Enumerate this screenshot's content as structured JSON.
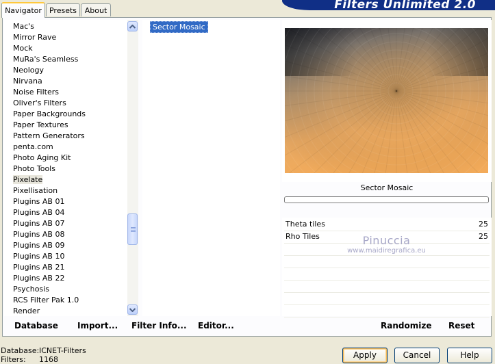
{
  "tabs": [
    "Navigator",
    "Presets",
    "About"
  ],
  "banner_title": "Filters Unlimited 2.0",
  "categories": [
    "Mac's",
    "Mirror Rave",
    "Mock",
    "MuRa's Seamless",
    "Neology",
    "Nirvana",
    "Noise Filters",
    "Oliver's Filters",
    "Paper Backgrounds",
    "Paper Textures",
    "Pattern Generators",
    "penta.com",
    "Photo Aging Kit",
    "Photo Tools",
    "Pixelate",
    "Pixellisation",
    "Plugins AB 01",
    "Plugins AB 04",
    "Plugins AB 07",
    "Plugins AB 08",
    "Plugins AB 09",
    "Plugins AB 10",
    "Plugins AB 21",
    "Plugins AB 22",
    "Psychosis",
    "RCS Filter Pak 1.0",
    "Render"
  ],
  "selected_category": "Pixelate",
  "filters": [
    "Sector Mosaic"
  ],
  "selected_filter": "Sector Mosaic",
  "preview": {
    "filter_name": "Sector Mosaic"
  },
  "params": [
    {
      "label": "Theta tiles",
      "value": "25"
    },
    {
      "label": "Rho Tiles",
      "value": "25"
    }
  ],
  "watermark": {
    "name": "Pinuccia",
    "site": "www.maidiregrafica.eu"
  },
  "bottom_left_buttons": [
    "Database",
    "Import...",
    "Filter Info...",
    "Editor..."
  ],
  "bottom_right_buttons": [
    "Randomize",
    "Reset"
  ],
  "status": {
    "database_label": "Database:",
    "database_value": "ICNET-Filters",
    "filters_label": "Filters:",
    "filters_value": "1168"
  },
  "dialog_buttons": {
    "apply": "Apply",
    "cancel": "Cancel",
    "help": "Help"
  },
  "colors": {
    "selection": "#316ac5",
    "banner": "#102f86",
    "accent_tab": "#ffc83c"
  }
}
